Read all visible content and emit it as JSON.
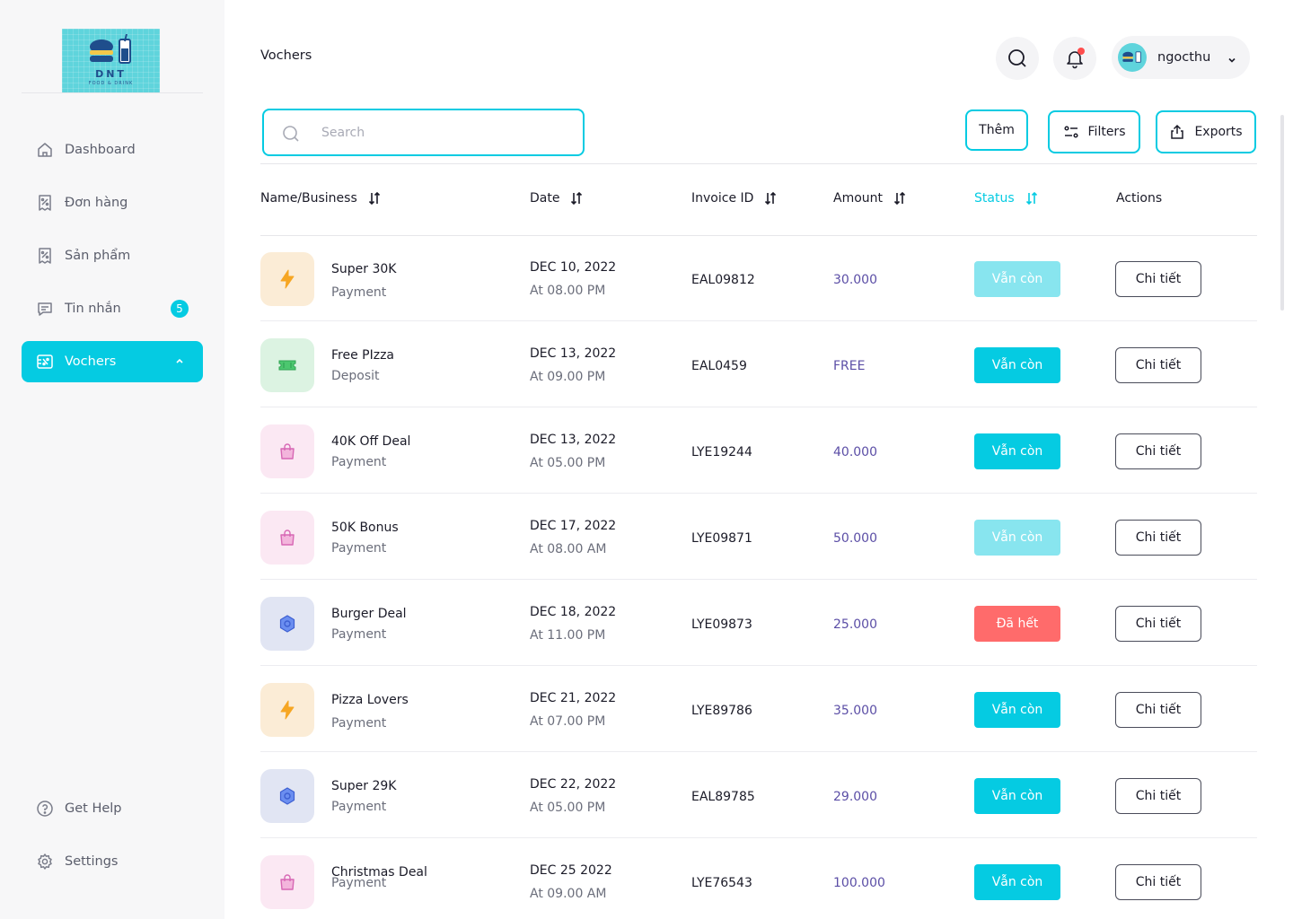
{
  "sidebar": {
    "logo": {
      "title": "DNT",
      "subtitle": "FOOD & DRINK"
    },
    "items": [
      {
        "label": "Dashboard",
        "icon": "home-icon"
      },
      {
        "label": "Đơn hàng",
        "icon": "receipt-icon"
      },
      {
        "label": "Sản phẩm",
        "icon": "receipt-icon"
      },
      {
        "label": "Tin nhắn",
        "icon": "message-icon",
        "badge": "5"
      },
      {
        "label": "Vochers",
        "icon": "voucher-icon",
        "active": true
      }
    ],
    "bottom": [
      {
        "label": "Get Help",
        "icon": "help-icon"
      },
      {
        "label": "Settings",
        "icon": "gear-icon"
      }
    ]
  },
  "header": {
    "title": "Vochers",
    "user": "ngocthu"
  },
  "toolbar": {
    "search_placeholder": "Search",
    "add_label": "Thêm",
    "filters_label": "Filters",
    "exports_label": "Exports"
  },
  "table": {
    "columns": [
      "Name/Business",
      "Date",
      "Invoice ID",
      "Amount",
      "Status",
      "Actions"
    ],
    "rows": [
      {
        "name": "Super 30K",
        "type": "Payment",
        "date": "DEC 10, 2022",
        "time": "At 08.00 PM",
        "invoice": "EAL09812",
        "amount": "30.000",
        "status": "Vẫn còn",
        "action": "Chi tiết"
      },
      {
        "name": "Free PIzza",
        "type": "Deposit",
        "date": "DEC 13, 2022",
        "time": "At 09.00 PM",
        "invoice": "EAL0459",
        "amount": "FREE",
        "status": "Vẫn còn",
        "action": "Chi tiết"
      },
      {
        "name": "40K Off Deal",
        "type": "Payment",
        "date": "DEC 13, 2022",
        "time": "At 05.00 PM",
        "invoice": "LYE19244",
        "amount": "40.000",
        "status": "Vẫn còn",
        "action": "Chi tiết"
      },
      {
        "name": "50K Bonus",
        "type": "Payment",
        "date": "DEC 17, 2022",
        "time": "At 08.00 AM",
        "invoice": "LYE09871",
        "amount": "50.000",
        "status": "Vẫn còn",
        "action": "Chi tiết"
      },
      {
        "name": "Burger Deal",
        "type": "Payment",
        "date": "DEC 18, 2022",
        "time": "At 11.00 PM",
        "invoice": "LYE09873",
        "amount": "25.000",
        "status": "Đã hết",
        "action": "Chi tiết"
      },
      {
        "name": "Pizza Lovers",
        "type": "Payment",
        "date": "DEC 21, 2022",
        "time": "At 07.00 PM",
        "invoice": "LYE89786",
        "amount": "35.000",
        "status": "Vẫn còn",
        "action": "Chi tiết"
      },
      {
        "name": "Super 29K",
        "type": "Payment",
        "date": "DEC 22, 2022",
        "time": "At 05.00 PM",
        "invoice": "EAL89785",
        "amount": "29.000",
        "status": "Vẫn còn",
        "action": "Chi tiết"
      },
      {
        "name": "Christmas Deal",
        "type": "Payment",
        "date": "DEC 25 2022",
        "time": "At 09.00 AM",
        "invoice": "LYE76543",
        "amount": "100.000",
        "status": "Vẫn còn",
        "action": "Chi tiết"
      }
    ]
  },
  "colors": {
    "accent": "#05cbe2",
    "accent_faded": "#88e5ef",
    "danger": "#ff6b6b",
    "amount": "#5b4ea6"
  }
}
